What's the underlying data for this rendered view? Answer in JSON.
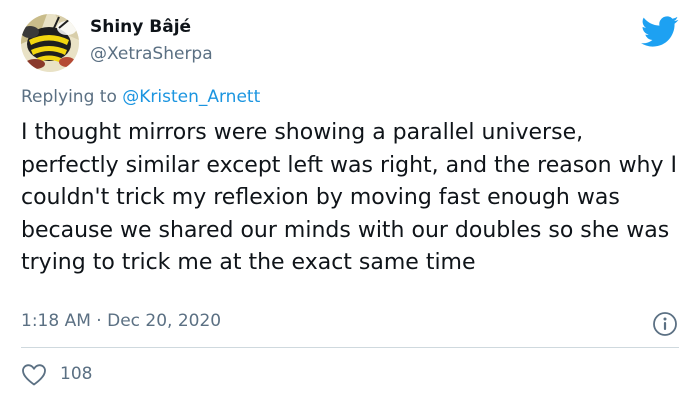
{
  "user": {
    "display_name": "Shiny Bâjé",
    "handle": "@XetraSherpa"
  },
  "reply": {
    "prefix": "Replying to ",
    "mention": "@Kristen_Arnett"
  },
  "tweet_text": "I thought mirrors were showing a parallel universe, perfectly similar except left was right, and the reason why I couldn't trick my reflexion by moving fast enough was because we shared our minds with our doubles so she was trying to trick me at the exact same time",
  "meta": {
    "time": "1:18 AM",
    "separator": " · ",
    "date": "Dec 20, 2020"
  },
  "engagement": {
    "likes": "108"
  },
  "icons": {
    "brand": "twitter-bird-icon",
    "info": "info-icon",
    "like": "heart-icon"
  },
  "colors": {
    "brand_blue": "#1da1f2",
    "link_blue": "#1b95e0",
    "secondary_text": "#5b7083",
    "primary_text": "#0f1419",
    "divider": "#cfd9de"
  }
}
